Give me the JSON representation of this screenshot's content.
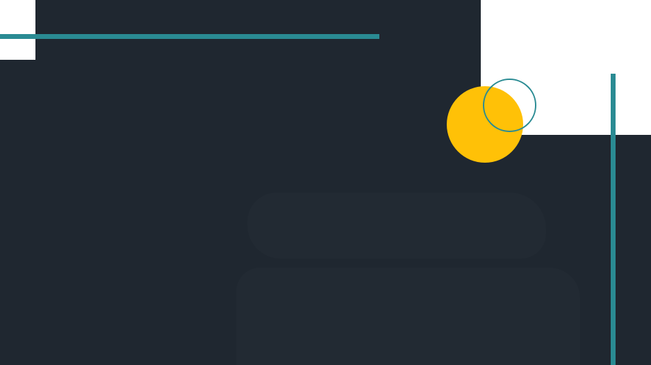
{
  "colors": {
    "background": "#1f2730",
    "white": "#ffffff",
    "teal": "#2a8b93",
    "yellow": "#ffc107",
    "ghost": "#222a33"
  },
  "decorations": [
    "white-corner-top-left",
    "white-corner-top-right",
    "teal-bar-horizontal",
    "teal-bar-vertical",
    "yellow-circle",
    "teal-ring",
    "ghost-shape-upper",
    "ghost-shape-lower"
  ]
}
